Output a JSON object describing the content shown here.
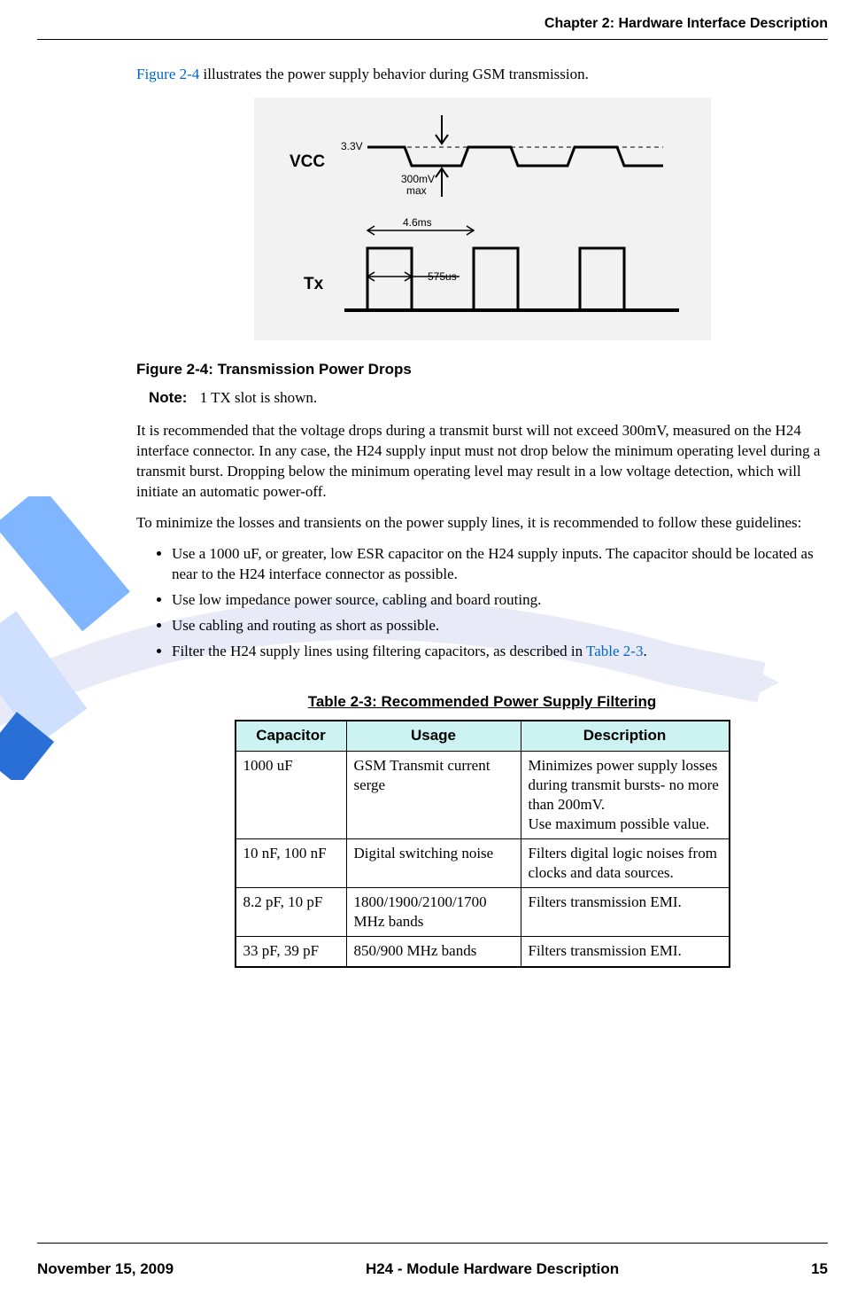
{
  "header": {
    "chapter": "Chapter 2:  Hardware Interface Description"
  },
  "intro": {
    "link": "Figure 2-4",
    "after": " illustrates the power supply behavior during GSM transmission."
  },
  "figure": {
    "labels": {
      "vcc": "VCC",
      "tx": "Tx",
      "v33": "3.3V",
      "mv300a": "300mV",
      "mv300b": "max",
      "ms46": "4.6ms",
      "us575": "575us"
    },
    "title": "Figure 2-4: Transmission Power Drops"
  },
  "note": {
    "label": "Note:",
    "text": "1 TX slot is shown."
  },
  "para1": "It is recommended that the voltage drops during a transmit burst will not exceed 300mV, measured on the H24 interface connector. In any case, the H24 supply input must not drop below the minimum operating level during a transmit burst. Dropping below the minimum operating level may result in a low voltage detection, which will initiate an automatic power-off.",
  "para2": "To minimize the losses and transients on the power supply lines, it is recommended to follow these guidelines:",
  "bullets": [
    "Use a 1000 uF, or greater, low ESR capacitor on the H24 supply inputs. The capacitor should be located as near to the H24 interface connector as possible.",
    "Use low impedance power source, cabling and board routing.",
    "Use cabling and routing as short as possible."
  ],
  "bullet4": {
    "before": "Filter the H24 supply lines using filtering capacitors, as described in ",
    "link": "Table 2-3",
    "after": "."
  },
  "table": {
    "title": "Table 2-3: Recommended Power Supply Filtering",
    "headers": [
      "Capacitor",
      "Usage",
      "Description"
    ],
    "rows": [
      {
        "cap": "1000 uF",
        "usage": "GSM Transmit current serge",
        "desc": "Minimizes power supply losses during transmit bursts- no more than 200mV.\nUse maximum possible value."
      },
      {
        "cap": "10 nF, 100 nF",
        "usage": "Digital switching noise",
        "desc": "Filters digital logic noises from clocks and data sources."
      },
      {
        "cap": "8.2 pF, 10 pF",
        "usage": "1800/1900/2100/1700 MHz bands",
        "desc": "Filters transmission EMI."
      },
      {
        "cap": "33 pF, 39 pF",
        "usage": "850/900 MHz bands",
        "desc": "Filters transmission EMI."
      }
    ]
  },
  "footer": {
    "left": "November 15, 2009",
    "center": "H24 - Module Hardware Description",
    "right": "15"
  }
}
